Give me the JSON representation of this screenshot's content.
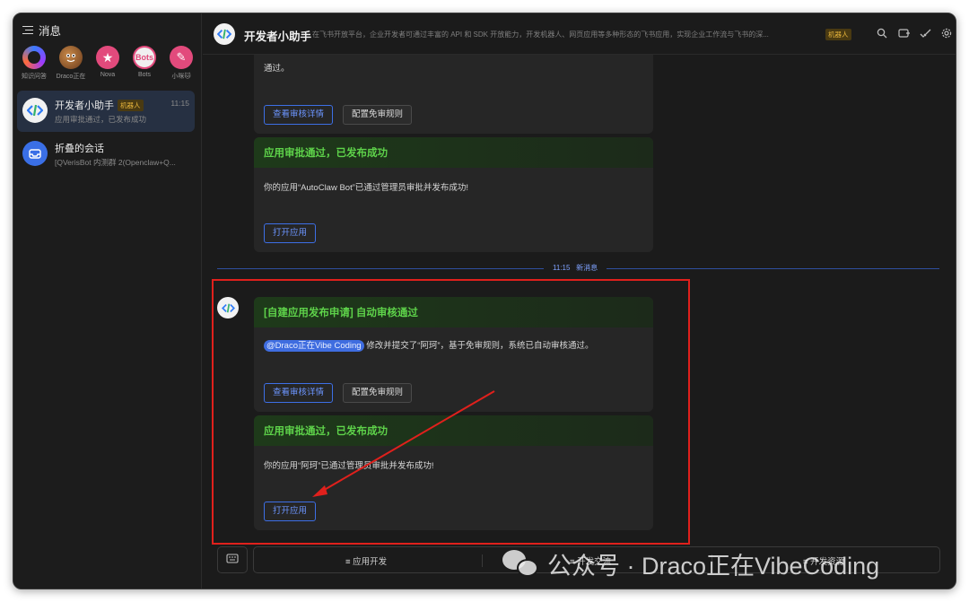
{
  "sidebar": {
    "title": "消息",
    "quick": [
      {
        "label": "知识问答",
        "text": "",
        "color": "#6a3bd6"
      },
      {
        "label": "Draco正在",
        "text": "",
        "color": "#7a4a2a"
      },
      {
        "label": "Nova",
        "text": "★",
        "color": "#e24a7c"
      },
      {
        "label": "Bots",
        "text": "Bots",
        "color": "#f0f0f0"
      },
      {
        "label": "小咪🐱",
        "text": "✎",
        "color": "#e24a7c"
      }
    ],
    "conversations": [
      {
        "name": "开发者小助手",
        "tag": "机器人",
        "preview": "应用审批通过，已发布成功",
        "time": "11:15"
      },
      {
        "name": "折叠的会话",
        "tag": "",
        "preview": "[QVerisBot 内测群 2(Openclaw+Q...",
        "time": ""
      }
    ]
  },
  "header": {
    "title": "开发者小助手",
    "description": "在飞书开放平台，企业开发者可通过丰富的 API 和 SDK 开放能力，开发机器人、网页应用等多种形态的飞书应用，实现企业工作流与飞书的深...",
    "tag": "机器人",
    "icons": [
      "search-icon",
      "add-icon",
      "check-icon",
      "gear-icon"
    ]
  },
  "messages": {
    "top_fragment": "通过。",
    "btn_view_detail": "查看审核详情",
    "btn_config_rules": "配置免审规则",
    "card_published_1": {
      "title": "应用审批通过，已发布成功",
      "body": "你的应用“AutoClaw Bot”已通过管理员审批并发布成功!",
      "button": "打开应用"
    },
    "divider_time": "11:15",
    "divider_label": "新消息",
    "card_auto_review": {
      "title": "[自建应用发布申请] 自动审核通过",
      "mention": "@Draco正在Vibe Coding",
      "body": "修改并提交了“阿珂”，基于免审规则，系统已自动审核通过。",
      "button_detail": "查看审核详情",
      "button_rules": "配置免审规则"
    },
    "card_published_2": {
      "title": "应用审批通过，已发布成功",
      "body": "你的应用“阿珂”已通过管理员审批并发布成功!",
      "button": "打开应用"
    }
  },
  "composer": {
    "menus": [
      "≡ 应用开发",
      "≡ 开发交流",
      "≡ 开发资源"
    ]
  },
  "watermark": "公众号 · Draco正在VibeCoding",
  "colors": {
    "accent": "#3d6fe6",
    "success": "#5ed34a",
    "highlight": "#e0201c"
  }
}
